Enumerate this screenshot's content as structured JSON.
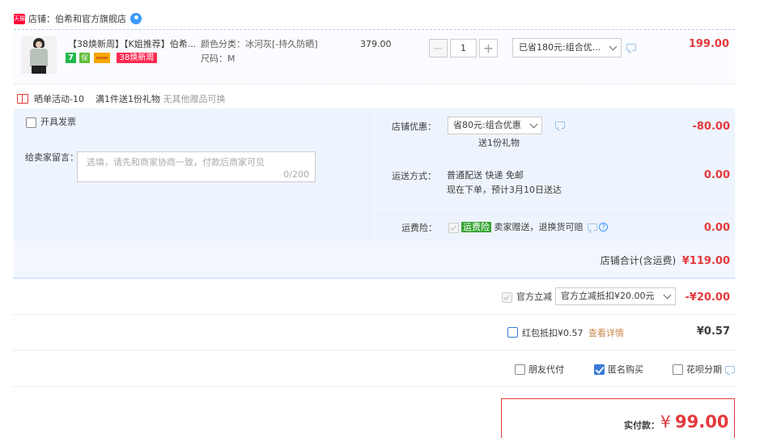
{
  "store": {
    "badge": "天猫",
    "label": "店铺：伯希和官方旗舰店",
    "chat_icon": "wangwang-icon"
  },
  "item": {
    "title": "【38焕新周】【K姐推荐】伯希...",
    "badges": {
      "seven": "7",
      "guarantee": "保",
      "card": "",
      "event": "38焕新周"
    },
    "sku_color": "颜色分类：冰河灰[-持久防晒]",
    "sku_size": "尺码：M",
    "unit_price": "379.00",
    "quantity": "1",
    "minus": "−",
    "plus": "+",
    "promo_select": "已省180元:组合优...",
    "total": "199.00"
  },
  "activity": {
    "text": "晒单活动-10",
    "gift": "满1件送1份礼物",
    "note": "无其他赠品可换"
  },
  "invoice": {
    "label": "开具发票",
    "checked": false
  },
  "message": {
    "label": "给卖家留言：",
    "placeholder": "选填，请先和商家协商一致，付款后商家可见",
    "count": "0/200"
  },
  "shop_discount": {
    "label": "店铺优惠：",
    "select": "省80元:组合优惠",
    "gift_note": "送1份礼物",
    "amount": "-80.00"
  },
  "shipping": {
    "label": "运送方式：",
    "line1": "普通配送 快递 免邮",
    "line2": "现在下单，预计3月10日送达",
    "amount": "0.00"
  },
  "insurance": {
    "label": "运费险：",
    "tag": "运费险",
    "text": "卖家赠送，退换货可赔",
    "amount": "0.00",
    "help": "?"
  },
  "shop_total": {
    "label": "店铺合计(含运费)",
    "amount": "¥119.00"
  },
  "official": {
    "label": "官方立减",
    "select": "官方立减抵扣¥20.00元",
    "amount": "-¥20.00"
  },
  "redpacket": {
    "label": "红包抵扣¥0.57",
    "link": "查看详情",
    "amount": "¥0.57"
  },
  "options": {
    "friend_pay": "朋友代付",
    "anonymous": "匿名购买",
    "huabei": "花呗分期",
    "anonymous_checked": true
  },
  "payment": {
    "label": "实付款：",
    "currency": "¥",
    "amount": "99.00"
  },
  "colors": {
    "accent": "#e4393c",
    "panel": "#eef4fd",
    "link": "#3b7bd8"
  }
}
